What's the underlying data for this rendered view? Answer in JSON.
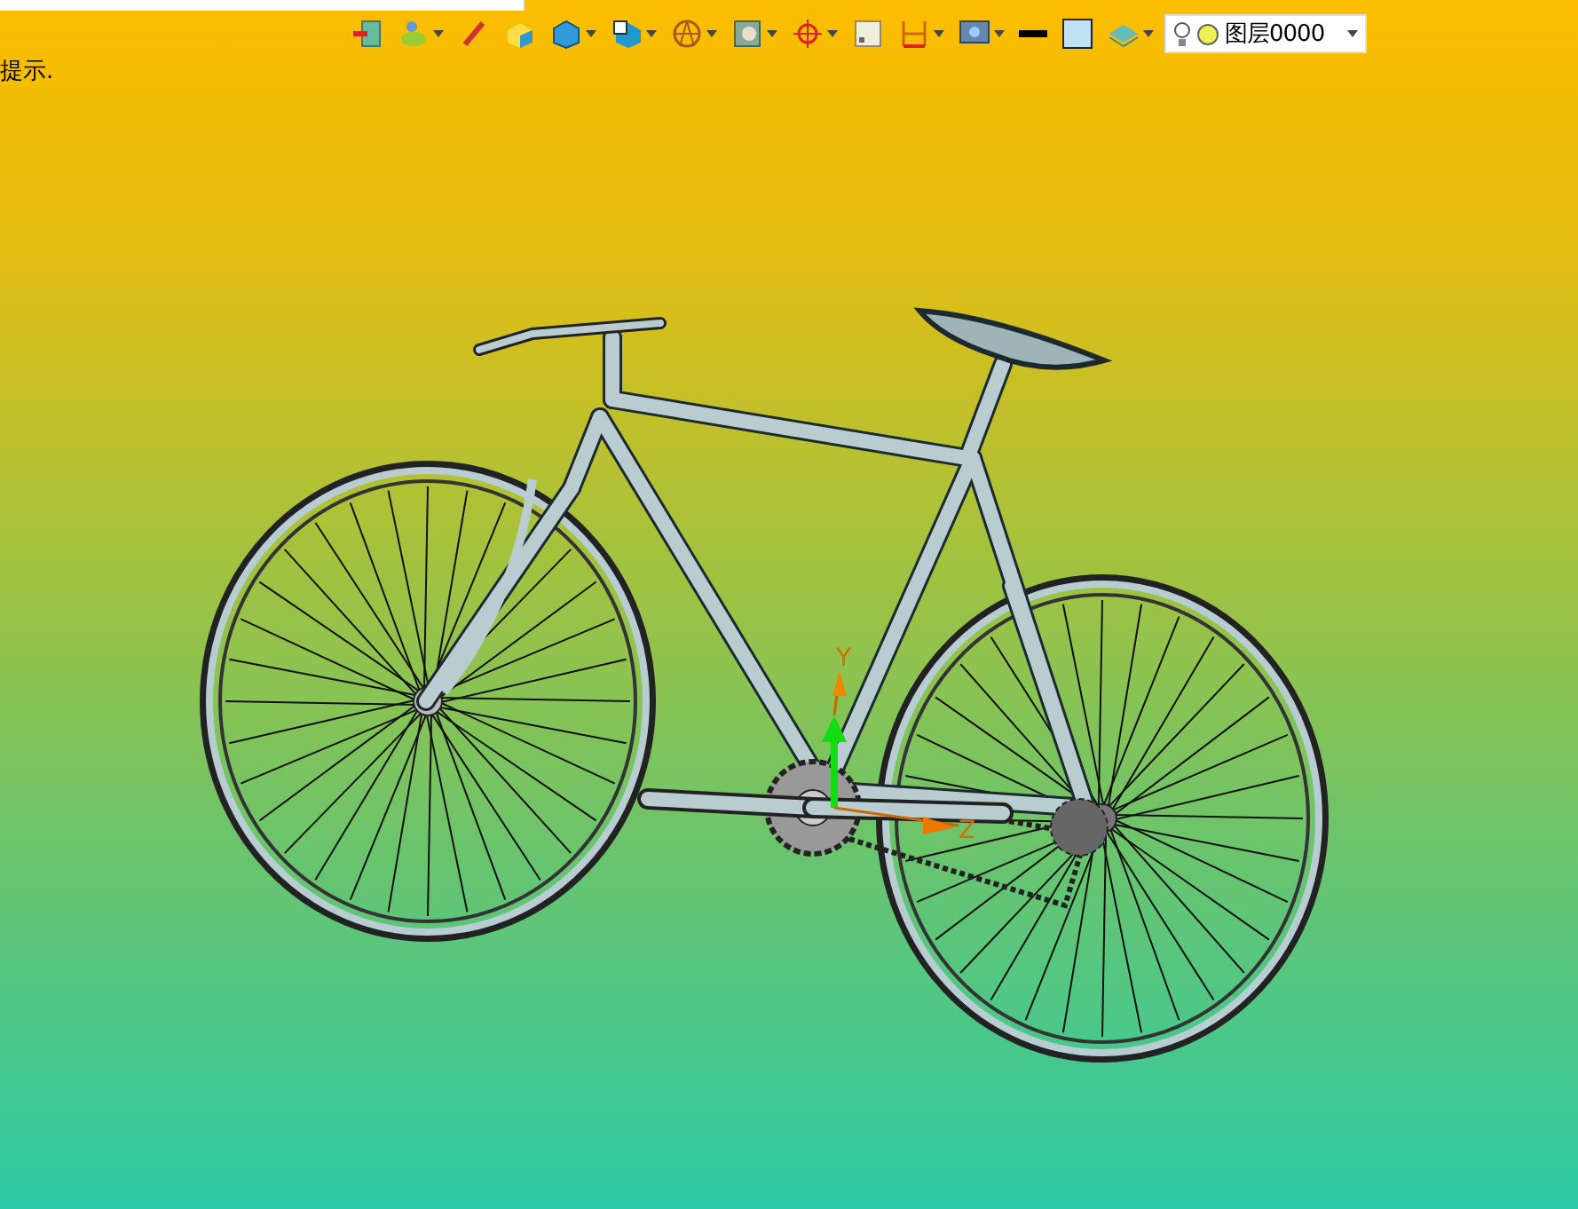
{
  "toolbar": {
    "layer": {
      "label": "图层0000"
    }
  },
  "hint": "提示.",
  "axes": [
    {
      "label": "Y"
    },
    {
      "label": "Z"
    }
  ]
}
